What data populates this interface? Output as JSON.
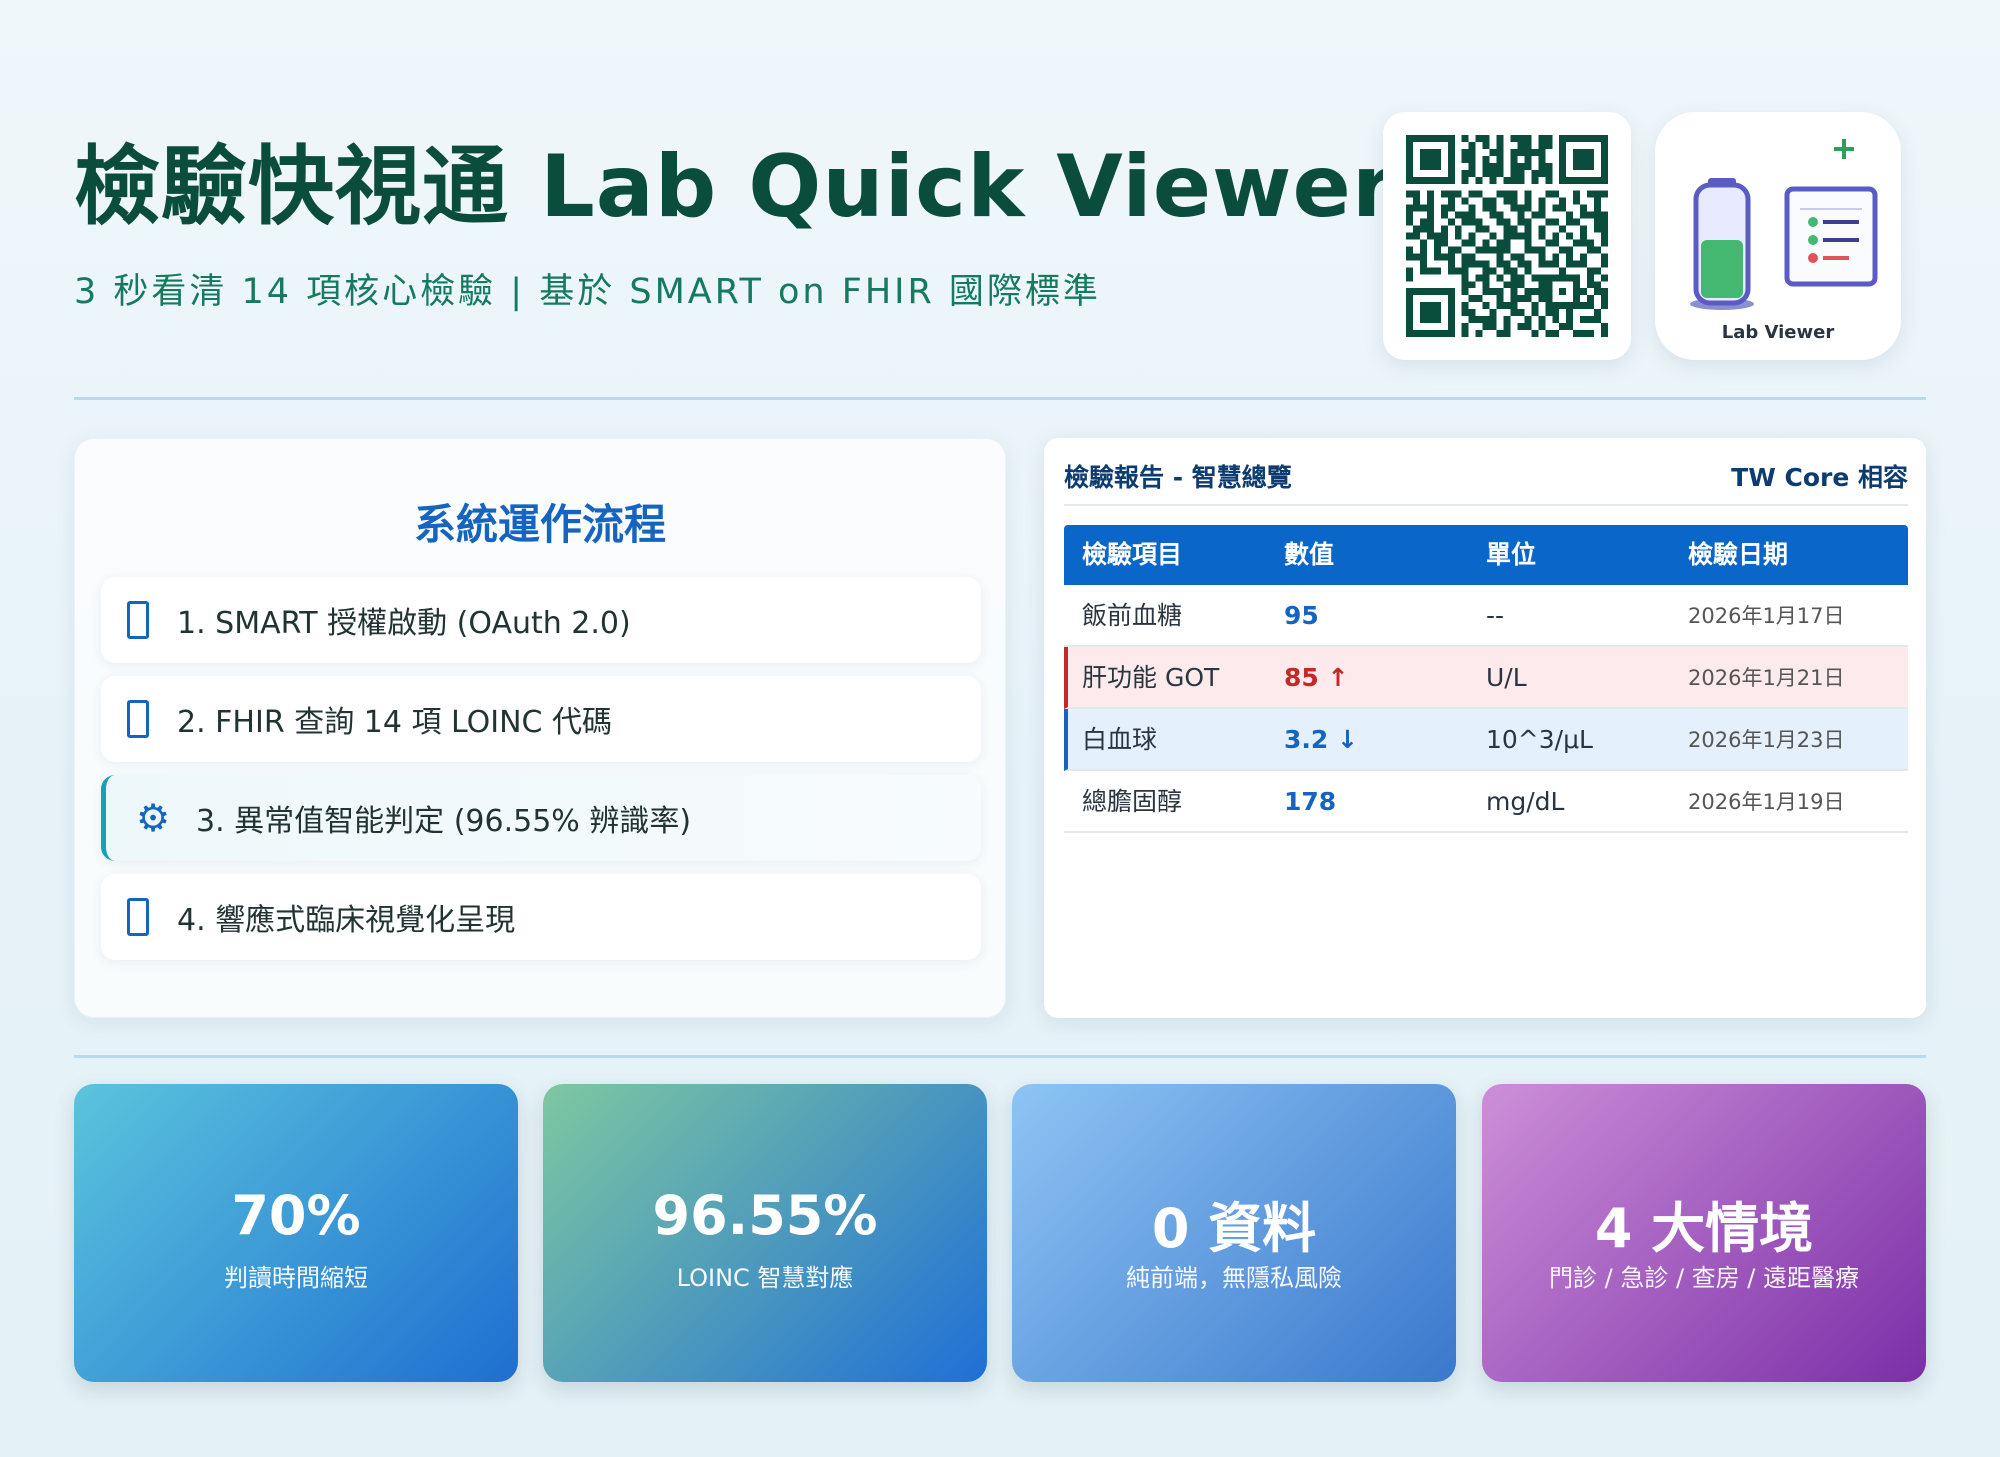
{
  "header": {
    "title": "檢驗快視通 Lab Quick Viewer",
    "subtitle": "3 秒看清 14 項核心檢驗 | 基於 SMART on FHIR 國際標準"
  },
  "logo": {
    "label": "Lab Viewer"
  },
  "flow": {
    "title": "系統運作流程",
    "steps": [
      {
        "label": "1. SMART 授權啟動 (OAuth 2.0)",
        "icon": "box-icon"
      },
      {
        "label": "2. FHIR 查詢 14 項 LOINC 代碼",
        "icon": "box-icon"
      },
      {
        "label": "3. 異常值智能判定 (96.55% 辨識率)",
        "icon": "gear-icon"
      },
      {
        "label": "4. 響應式臨床視覺化呈現",
        "icon": "box-icon"
      }
    ]
  },
  "report": {
    "title": "檢驗報告 - 智慧總覽",
    "badge": "TW Core 相容",
    "columns": [
      "檢驗項目",
      "數值",
      "單位",
      "檢驗日期"
    ],
    "rows": [
      {
        "item": "飯前血糖",
        "value": "95",
        "unit": "--",
        "date": "2026年1月17日",
        "status": "normal"
      },
      {
        "item": "肝功能 GOT",
        "value": "85 ↑",
        "unit": "U/L",
        "date": "2026年1月21日",
        "status": "high"
      },
      {
        "item": "白血球",
        "value": "3.2 ↓",
        "unit": "10^3/μL",
        "date": "2026年1月23日",
        "status": "low"
      },
      {
        "item": "總膽固醇",
        "value": "178",
        "unit": "mg/dL",
        "date": "2026年1月19日",
        "status": "normal"
      }
    ]
  },
  "stats": [
    {
      "big": "70%",
      "small": "判讀時間縮短",
      "gradient": [
        "#5bc4dd",
        "#1e6fd0"
      ]
    },
    {
      "big": "96.55%",
      "small": "LOINC 智慧對應",
      "gradient": [
        "#7ec8a0",
        "#1f6fd6"
      ]
    },
    {
      "big": "0 資料",
      "small": "純前端，無隱私風險",
      "gradient": [
        "#8ec4f4",
        "#3a78cc"
      ]
    },
    {
      "big": "4 大情境",
      "small": "門診 / 急診 / 查房 / 遠距醫療",
      "gradient": [
        "#cd8fd8",
        "#7b2fa8"
      ]
    }
  ],
  "colors": {
    "title": "#0b4d3c",
    "subtitle": "#157a5e",
    "accent_blue": "#0b66c9",
    "high": "#c62828",
    "low": "#1565c0"
  }
}
